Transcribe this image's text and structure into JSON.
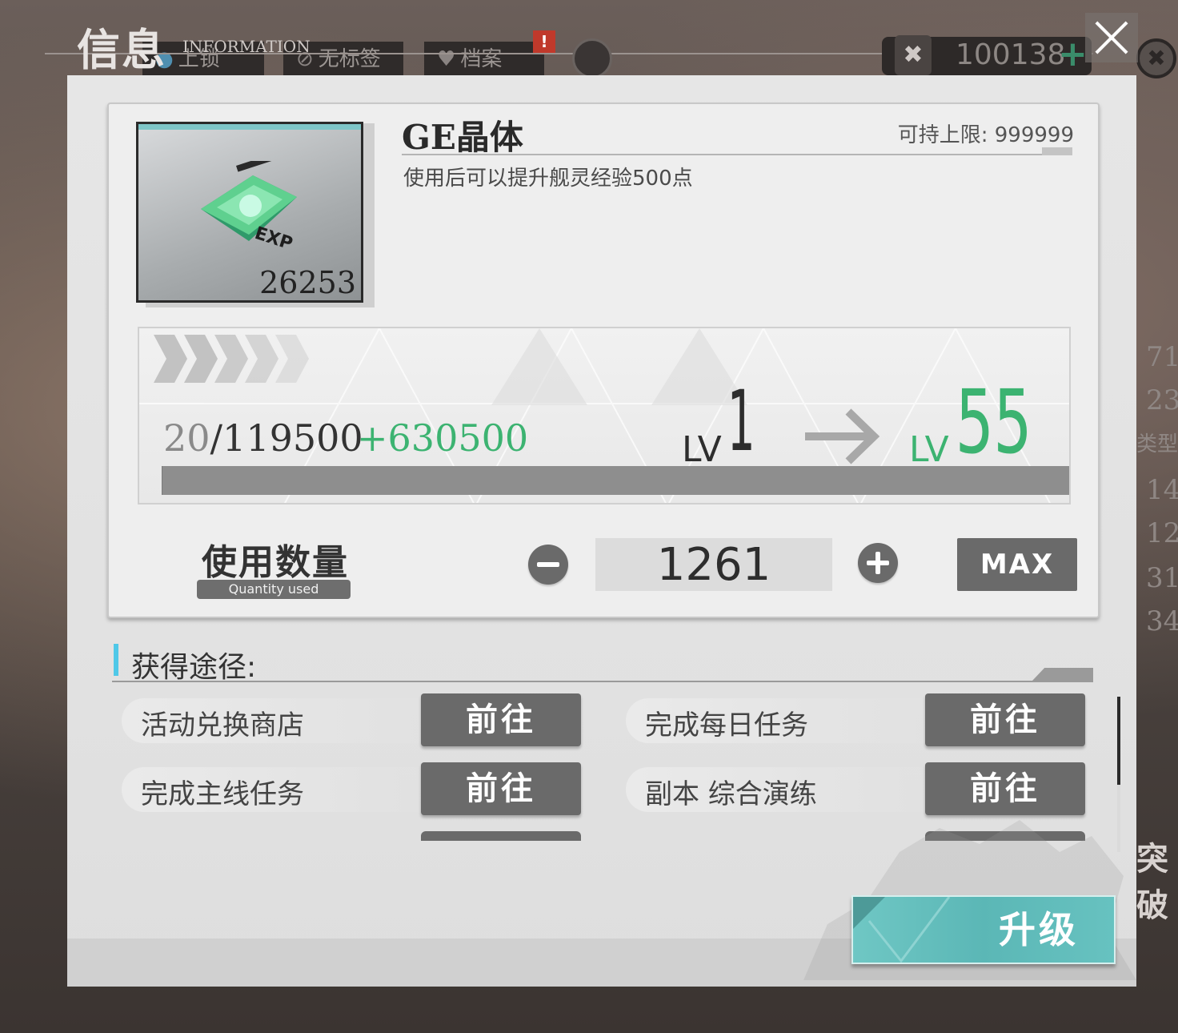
{
  "header": {
    "title": "信息",
    "subtitle": "INFORMATION",
    "alert": "!",
    "currency_value": "100138",
    "currency_plus": "+"
  },
  "background_tabs": [
    {
      "label": "上锁"
    },
    {
      "label": "无标签"
    },
    {
      "label": "档案"
    }
  ],
  "background_side_numbers": [
    "71",
    "23",
    "类型",
    "14",
    "12",
    "31",
    "34",
    "突破"
  ],
  "item": {
    "name": "GE晶体",
    "limit_label": "可持上限: 999999",
    "description": "使用后可以提升舰灵经验500点",
    "count": "26253",
    "icon_tag": "EXP"
  },
  "level": {
    "exp_current": "20",
    "exp_separator": "/",
    "exp_required": "119500",
    "exp_gain": "+630500",
    "lv_label": "LV",
    "from_level": "1",
    "to_level": "55",
    "progress_fraction": 0.0002
  },
  "quantity": {
    "label": "使用数量",
    "sublabel": "Quantity used",
    "value": "1261",
    "max_label": "MAX"
  },
  "sources": {
    "title": "获得途径:",
    "items": [
      {
        "label": "活动兑换商店",
        "button": "前往"
      },
      {
        "label": "完成每日任务",
        "button": "前往"
      },
      {
        "label": "完成主线任务",
        "button": "前往"
      },
      {
        "label": "副本 综合演练",
        "button": "前往"
      }
    ]
  },
  "upgrade_button": "升级",
  "colors": {
    "accent_green": "#3cb371",
    "accent_teal": "#5bb7b6",
    "accent_blue": "#4fc8e8",
    "button_gray": "#6a6a6a"
  }
}
